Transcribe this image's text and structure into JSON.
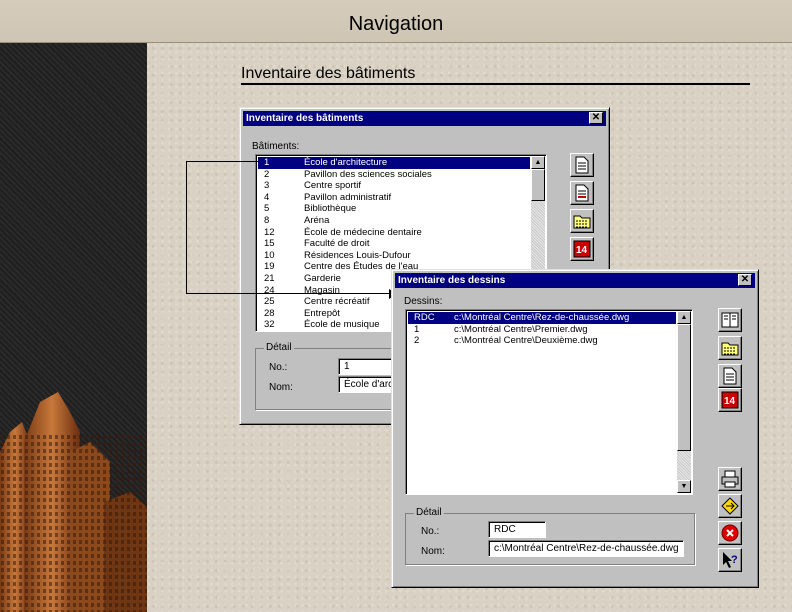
{
  "slide": {
    "title": "Navigation",
    "section_title": "Inventaire des bâtiments"
  },
  "buildings_window": {
    "title": "Inventaire des bâtiments",
    "close_glyph": "✕",
    "list_label": "Bâtiments:",
    "rows": [
      {
        "no": "1",
        "name": "École d'architecture",
        "selected": true
      },
      {
        "no": "2",
        "name": "Pavillon des sciences sociales"
      },
      {
        "no": "3",
        "name": "Centre sportif"
      },
      {
        "no": "4",
        "name": "Pavillon administratif"
      },
      {
        "no": "5",
        "name": "Bibliothèque"
      },
      {
        "no": "8",
        "name": "Aréna"
      },
      {
        "no": "12",
        "name": "École de médecine dentaire"
      },
      {
        "no": "15",
        "name": "Faculté de droit"
      },
      {
        "no": "10",
        "name": "Résidences Louis-Dufour"
      },
      {
        "no": "19",
        "name": "Centre des Études de l'eau"
      },
      {
        "no": "21",
        "name": "Garderie"
      },
      {
        "no": "24",
        "name": "Magasin"
      },
      {
        "no": "25",
        "name": "Centre récréatif"
      },
      {
        "no": "28",
        "name": "Entrepôt"
      },
      {
        "no": "32",
        "name": "École de musique"
      }
    ],
    "detail_caption": "Détail",
    "no_label": "No.:",
    "nom_label": "Nom:",
    "no_value": "1",
    "nom_value": "École d'architecture",
    "toolbar": [
      {
        "icon": "document-icon"
      },
      {
        "icon": "document-red-icon"
      },
      {
        "icon": "folder-list-icon"
      },
      {
        "icon": "calendar-14-icon",
        "text": "14"
      }
    ]
  },
  "drawings_window": {
    "title": "Inventaire des dessins",
    "close_glyph": "✕",
    "list_label": "Dessins:",
    "rows": [
      {
        "no": "RDC",
        "file": "c:\\Montréal Centre\\Rez-de-chaussée.dwg",
        "selected": true
      },
      {
        "no": "1",
        "file": "c:\\Montréal Centre\\Premier.dwg"
      },
      {
        "no": "2",
        "file": "c:\\Montréal Centre\\Deuxième.dwg"
      }
    ],
    "detail_caption": "Détail",
    "no_label": "No.:",
    "nom_label": "Nom:",
    "no_value": "RDC",
    "nom_value": "c:\\Montréal Centre\\Rez-de-chaussée.dwg",
    "toolbar_top": [
      {
        "icon": "book-icon"
      },
      {
        "icon": "folder-list-icon"
      },
      {
        "icon": "document-icon"
      },
      {
        "icon": "calendar-14-icon",
        "text": "14"
      }
    ],
    "toolbar_bottom": [
      {
        "icon": "printer-icon"
      },
      {
        "icon": "navigate-icon"
      },
      {
        "icon": "close-red-icon"
      },
      {
        "icon": "help-pointer-icon"
      }
    ]
  }
}
